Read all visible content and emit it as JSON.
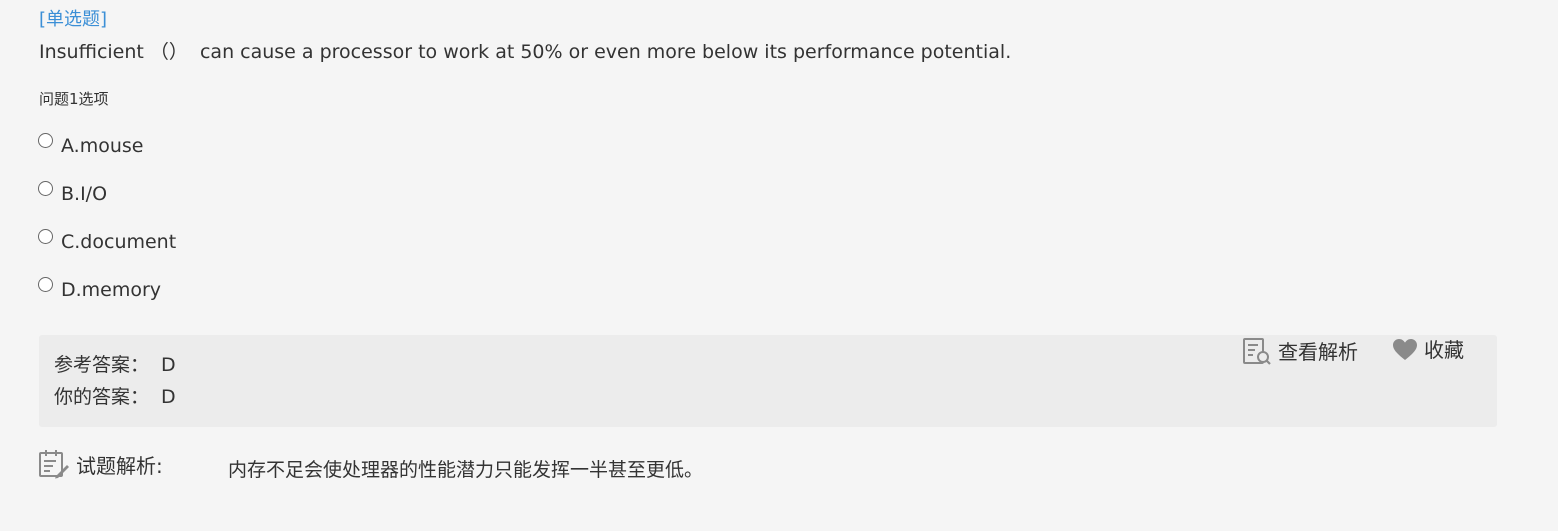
{
  "question": {
    "type_label": "[单选题]",
    "text": "Insufficient （）  can cause a processor to work at 50% or even more below its performance potential.",
    "options_label": "问题1选项",
    "options": [
      {
        "label": "A.mouse"
      },
      {
        "label": "B.I/O"
      },
      {
        "label": "C.document"
      },
      {
        "label": "D.memory"
      }
    ]
  },
  "answer": {
    "reference_label": "参考答案：",
    "reference_value": "D",
    "yours_label": "你的答案：",
    "yours_value": "D",
    "view_analysis_label": "查看解析",
    "favorite_label": "收藏"
  },
  "analysis": {
    "title": "试题解析:",
    "text": "内存不足会使处理器的性能潜力只能发挥一半甚至更低。"
  },
  "colors": {
    "accent_blue": "#3b8fd6",
    "text": "#333333",
    "page_background": "#f5f5f5",
    "answer_background": "#ececec",
    "icon_gray": "#888888"
  },
  "icons": {
    "view_analysis": "magnifier-document-icon",
    "favorite": "heart-icon",
    "analysis": "edit-document-icon"
  }
}
